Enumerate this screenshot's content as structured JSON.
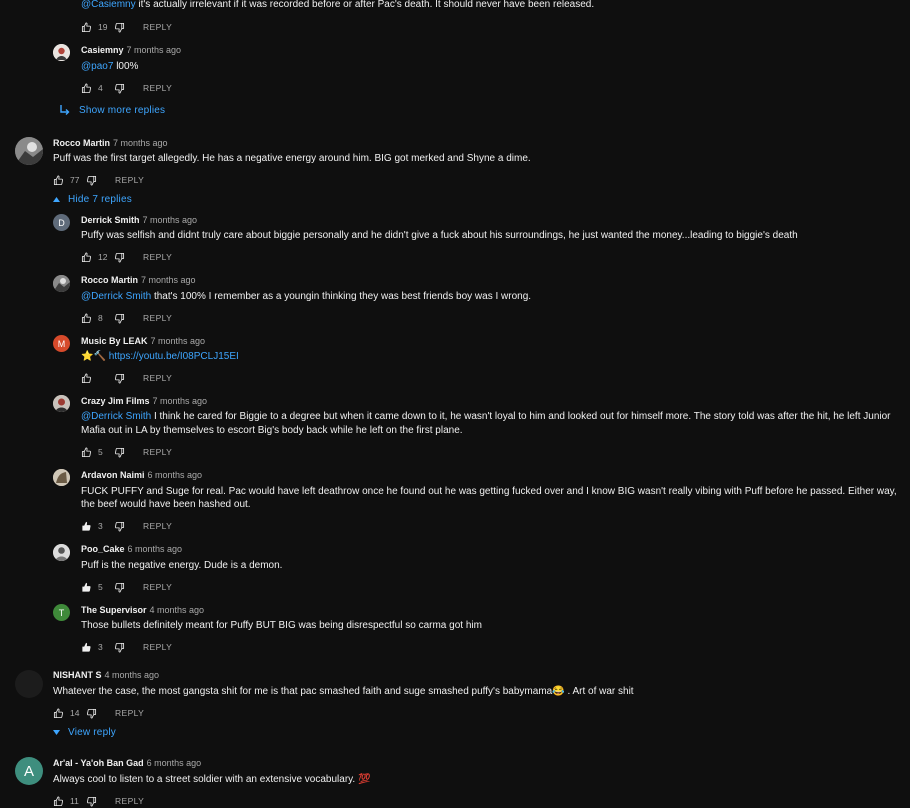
{
  "thread0": {
    "top": {
      "author": "@Casiemny",
      "text": "it's actually irrelevant if it was recorded before or after Pac's death. It should never have been released.",
      "likes": "19",
      "reply": "REPLY"
    },
    "reply": {
      "author": "Casiemny",
      "time": "7 months ago",
      "mention": "@pao7",
      "text": "l00%",
      "likes": "4",
      "reply": "REPLY"
    },
    "show_more": "Show more replies"
  },
  "thread1": {
    "author": "Rocco Martin",
    "time": "7 months ago",
    "text": "Puff was the first target allegedly. He has a negative energy around him. BIG got merked and Shyne a dime.",
    "likes": "77",
    "reply": "REPLY",
    "toggle": "Hide 7 replies",
    "replies": [
      {
        "author": "Derrick Smith",
        "time": "7 months ago",
        "initial": "D",
        "avatar_color": "#5f6b7a",
        "text": "Puffy was selfish and didnt truly care about biggie personally and he didn't give a fuck about his surroundings, he just wanted the money...leading to biggie's death",
        "likes": "12",
        "reply": "REPLY"
      },
      {
        "author": "Rocco Martin",
        "time": "7 months ago",
        "mention": "@Derrick Smith",
        "text": "that's 100% I remember as a youngin thinking they was best friends boy was I wrong.",
        "likes": "8",
        "reply": "REPLY"
      },
      {
        "author": "Music By LEAK",
        "time": "7 months ago",
        "initial": "M",
        "avatar_color": "#d64a2b",
        "emoji": "⭐🔨",
        "link": "https://youtu.be/I08PCLJ15EI",
        "likes": "",
        "reply": "REPLY"
      },
      {
        "author": "Crazy Jim Films",
        "time": "7 months ago",
        "mention": "@Derrick Smith",
        "text": "I think he cared for Biggie to a degree but when it came down to it, he wasn't loyal to him and looked out for himself more.  The story told was after the hit, he left Junior",
        "text2": "Mafia out in LA by themselves to escort Big's body back while he left on the first plane.",
        "likes": "5",
        "reply": "REPLY"
      },
      {
        "author": "Ardavon Naimi",
        "time": "6 months ago",
        "text": "FUCK PUFFY and Suge for real. Pac would have left deathrow once he found out he was getting fucked over and I know BIG wasn't really vibing with Puff before he passed. Either way,",
        "text2": "the beef would have been hashed out.",
        "likes": "3",
        "reply": "REPLY"
      },
      {
        "author": "Poo_Cake",
        "time": "6 months ago",
        "text": "Puff is the negative energy. Dude is a demon.",
        "likes": "5",
        "reply": "REPLY"
      },
      {
        "author": "The Supervisor",
        "time": "4 months ago",
        "initial": "T",
        "avatar_color": "#3f8a3a",
        "text": "Those bullets definitely meant for Puffy BUT BIG was being disrespectful so carma got him",
        "likes": "3",
        "reply": "REPLY"
      }
    ]
  },
  "thread2": {
    "author": "NISHANT S",
    "time": "4 months ago",
    "text": "Whatever the case, the most gangsta shit for me is that pac smashed faith and suge smashed puffy's babymama",
    "emoji": "😂",
    "text_after": ". Art of war shit",
    "likes": "14",
    "reply": "REPLY",
    "toggle": "View reply"
  },
  "thread3": {
    "author": "Ar'al - Ya'oh Ban Gad",
    "time": "6 months ago",
    "initial": "A",
    "avatar_color": "#3e8e7e",
    "text": "Always cool to listen to a street soldier with an extensive vocabulary.",
    "emoji": "💯",
    "likes": "11",
    "reply": "REPLY"
  },
  "colors": {
    "background": "#0f0f0f",
    "text": "#f1f1f1",
    "secondary": "#aaaaaa",
    "link": "#3ea6ff"
  }
}
